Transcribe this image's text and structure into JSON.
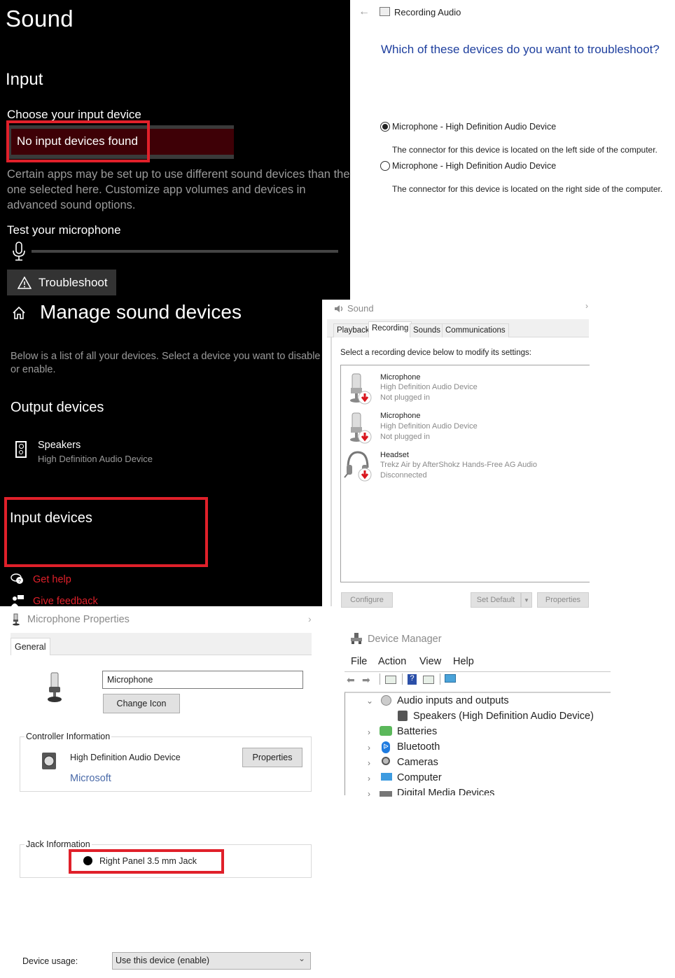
{
  "sound_settings": {
    "title": "Sound",
    "section": "Input",
    "choose_label": "Choose your input device",
    "dropdown_value": "No input devices found",
    "description": "Certain apps may be set up to use different sound devices than the one selected here. Customize app volumes and devices in advanced sound options.",
    "test_label": "Test your microphone",
    "mic_level_percent": 0,
    "troubleshoot_label": "Troubleshoot",
    "accent_color": "#e0202a",
    "dropdown_color": "#3e0006"
  },
  "troubleshooter": {
    "app_title": "Recording Audio",
    "question": "Which of these devices do you want to troubleshoot?",
    "options": [
      {
        "label": "Microphone - High Definition Audio Device",
        "detail": "The connector for this device is located on the left side of the computer.",
        "selected": true
      },
      {
        "label": "Microphone - High Definition Audio Device",
        "detail": "The connector for this device is located on the right side of the computer.",
        "selected": false
      }
    ],
    "question_color": "#1e3f9e"
  },
  "manage_devices": {
    "title": "Manage sound devices",
    "description": "Below is a list of all your devices. Select a device you want to disable or enable.",
    "output_heading": "Output devices",
    "output_devices": [
      {
        "name": "Speakers",
        "subtitle": "High Definition Audio Device"
      }
    ],
    "input_heading": "Input devices",
    "links": [
      "Get help",
      "Give feedback"
    ]
  },
  "sound_panel": {
    "title": "Sound",
    "tabs": [
      "Playback",
      "Recording",
      "Sounds",
      "Communications"
    ],
    "active_tab": "Recording",
    "instruction": "Select a recording device below to modify its settings:",
    "devices": [
      {
        "name": "Microphone",
        "driver": "High Definition Audio Device",
        "status": "Not plugged in",
        "icon": "microphone-icon"
      },
      {
        "name": "Microphone",
        "driver": "High Definition Audio Device",
        "status": "Not plugged in",
        "icon": "microphone-icon"
      },
      {
        "name": "Headset",
        "driver": "Trekz Air by AfterShokz Hands-Free AG Audio",
        "status": "Disconnected",
        "icon": "headset-icon"
      }
    ],
    "buttons": {
      "configure": "Configure",
      "set_default": "Set Default",
      "properties": "Properties"
    }
  },
  "mic_properties": {
    "title": "Microphone Properties",
    "tab": "General",
    "name_value": "Microphone",
    "change_icon": "Change Icon",
    "controller_group": "Controller Information",
    "controller_name": "High Definition Audio Device",
    "controller_vendor": "Microsoft",
    "properties_button": "Properties",
    "jack_group": "Jack Information",
    "jack_value": "Right Panel 3.5 mm Jack",
    "usage_label": "Device usage:",
    "usage_value": "Use this device (enable)"
  },
  "device_manager": {
    "title": "Device Manager",
    "menu": [
      "File",
      "Action",
      "View",
      "Help"
    ],
    "tree": [
      {
        "label": "Audio inputs and outputs",
        "expanded": true,
        "children": [
          "Speakers (High Definition Audio Device)"
        ]
      },
      {
        "label": "Batteries",
        "expanded": false
      },
      {
        "label": "Bluetooth",
        "expanded": false
      },
      {
        "label": "Cameras",
        "expanded": false
      },
      {
        "label": "Computer",
        "expanded": false
      },
      {
        "label": "Digital Media Devices",
        "expanded": false
      }
    ]
  }
}
